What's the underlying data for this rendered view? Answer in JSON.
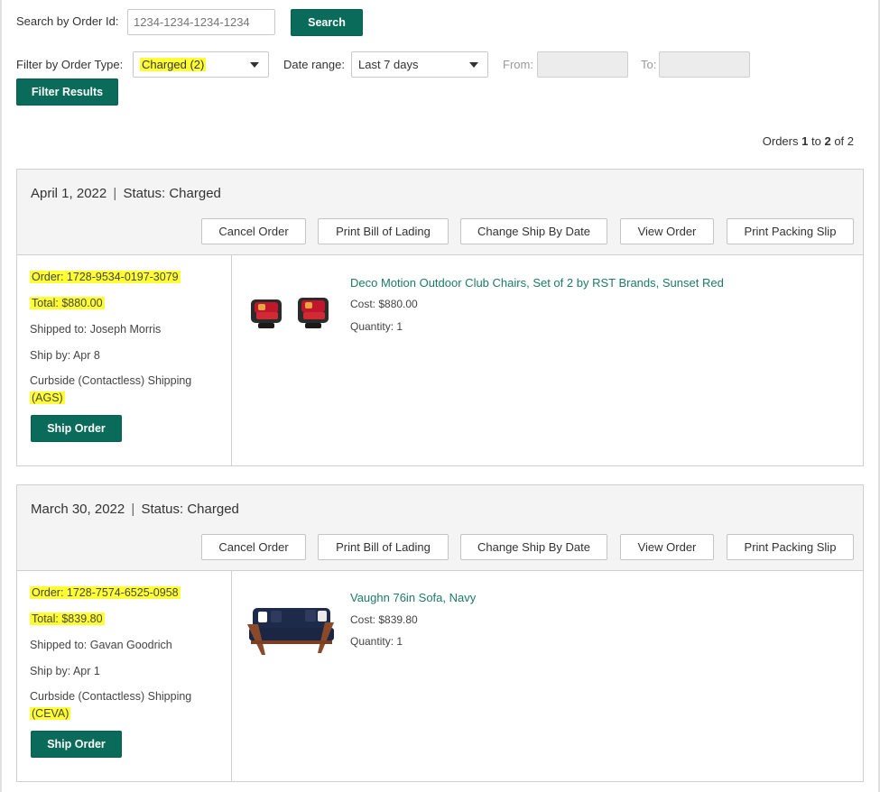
{
  "search": {
    "label": "Search by Order Id:",
    "placeholder": "1234-1234-1234-1234",
    "button": "Search"
  },
  "filter": {
    "type_label": "Filter by Order Type:",
    "type_value": "Charged (2)",
    "range_label": "Date range:",
    "range_value": "Last 7 days",
    "from_label": "From:",
    "to_label": "To:",
    "button": "Filter Results"
  },
  "pager": {
    "prefix": "Orders",
    "start": "1",
    "mid": "to",
    "end": "2",
    "of": "of 2"
  },
  "orders": [
    {
      "date": "April 1, 2022",
      "status_sep": "|",
      "status": "Status: Charged",
      "actions": [
        "Cancel Order",
        "Print Bill of Lading",
        "Change Ship By Date",
        "View Order",
        "Print Packing Slip"
      ],
      "order_id": "Order: 1728-9534-0197-3079",
      "total": "Total: $880.00",
      "shipped_to": "Shipped to: Joseph Morris",
      "ship_by": "Ship by: Apr 8",
      "shipping_method": "Curbside (Contactless) Shipping",
      "carrier": "(AGS)",
      "ship_button": "Ship Order",
      "product": {
        "name": "Deco Motion Outdoor Club Chairs, Set of 2 by RST Brands, Sunset Red",
        "cost": "Cost: $880.00",
        "quantity": "Quantity: 1"
      }
    },
    {
      "date": "March 30, 2022",
      "status_sep": "|",
      "status": "Status: Charged",
      "actions": [
        "Cancel Order",
        "Print Bill of Lading",
        "Change Ship By Date",
        "View Order",
        "Print Packing Slip"
      ],
      "order_id": "Order: 1728-7574-6525-0958",
      "total": "Total: $839.80",
      "shipped_to": "Shipped to: Gavan Goodrich",
      "ship_by": "Ship by: Apr 1",
      "shipping_method": "Curbside (Contactless) Shipping",
      "carrier": "(CEVA)",
      "ship_button": "Ship Order",
      "product": {
        "name": "Vaughn 76in Sofa, Navy",
        "cost": "Cost: $839.80",
        "quantity": "Quantity: 1"
      }
    }
  ],
  "colors": {
    "primary": "#0b6b5a",
    "highlight": "#ffff33",
    "link": "#1d7a66"
  }
}
